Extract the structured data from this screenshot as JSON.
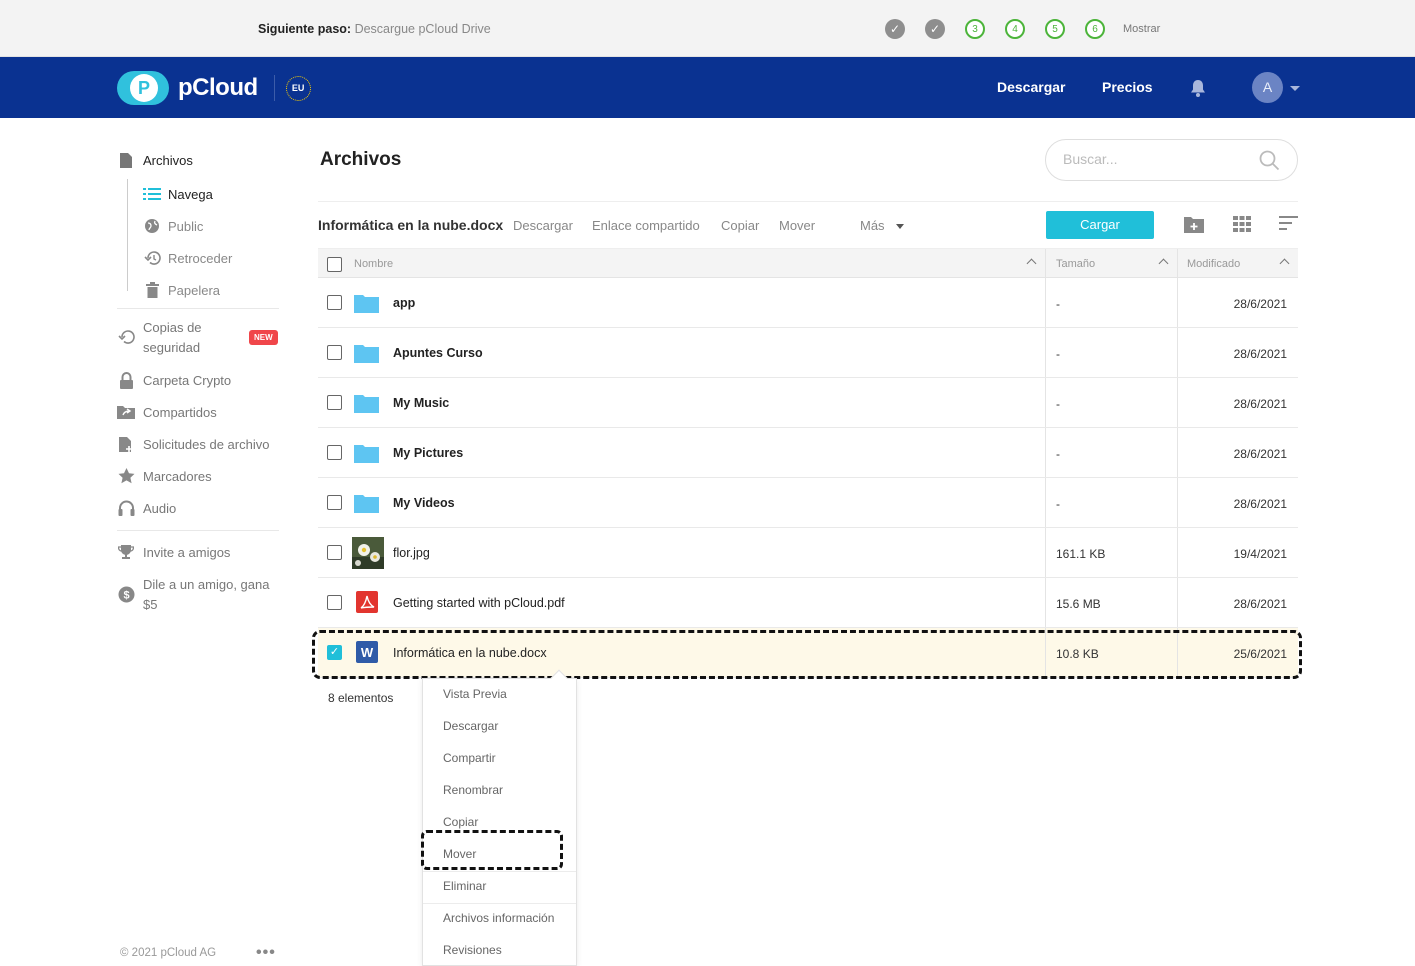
{
  "onboarding": {
    "next_label": "Siguiente paso:",
    "next_value": "Descargue pCloud Drive",
    "steps": [
      "✓",
      "✓",
      "3",
      "4",
      "5",
      "6"
    ],
    "show_label": "Mostrar"
  },
  "header": {
    "logo_text": "pCloud",
    "logo_letter": "P",
    "region_badge": "EU",
    "download_label": "Descargar",
    "pricing_label": "Precios",
    "avatar_letter": "A"
  },
  "sidebar": {
    "files_label": "Archivos",
    "sub": {
      "browse": "Navega",
      "public": "Public",
      "rewind": "Retroceder",
      "trash": "Papelera"
    },
    "backup_line1": "Copias de",
    "backup_line2": "seguridad",
    "new_badge": "NEW",
    "crypto": "Carpeta Crypto",
    "shared": "Compartidos",
    "file_requests": "Solicitudes de archivo",
    "bookmarks": "Marcadores",
    "audio": "Audio",
    "invite": "Invite a amigos",
    "refer_line1": "Dile a un amigo, gana",
    "refer_line2": "$5",
    "copyright": "© 2021 pCloud AG",
    "more": "•••"
  },
  "main": {
    "title": "Archivos",
    "search_placeholder": "Buscar...",
    "toolbar": {
      "selected_name": "Informática en la nube.docx",
      "download": "Descargar",
      "share_link": "Enlace compartido",
      "copy": "Copiar",
      "move": "Mover",
      "more": "Más",
      "upload": "Cargar"
    },
    "columns": {
      "name": "Nombre",
      "size": "Tamaño",
      "modified": "Modificado"
    },
    "rows": [
      {
        "name": "app",
        "size": "-",
        "date": "28/6/2021"
      },
      {
        "name": "Apuntes Curso",
        "size": "-",
        "date": "28/6/2021"
      },
      {
        "name": "My Music",
        "size": "-",
        "date": "28/6/2021"
      },
      {
        "name": "My Pictures",
        "size": "-",
        "date": "28/6/2021"
      },
      {
        "name": "My Videos",
        "size": "-",
        "date": "28/6/2021"
      },
      {
        "name": "flor.jpg",
        "size": "161.1 KB",
        "date": "19/4/2021"
      },
      {
        "name": "Getting started with pCloud.pdf",
        "size": "15.6 MB",
        "date": "28/6/2021"
      },
      {
        "name": "Informática en la nube.docx",
        "size": "10.8 KB",
        "date": "25/6/2021"
      }
    ],
    "count": "8 elementos"
  },
  "context_menu": {
    "preview": "Vista Previa",
    "download": "Descargar",
    "share": "Compartir",
    "rename": "Renombrar",
    "copy": "Copiar",
    "move": "Mover",
    "delete": "Eliminar",
    "file_info": "Archivos información",
    "revisions": "Revisiones"
  },
  "colors": {
    "header_bg": "#0a3291",
    "accent": "#20bfd9",
    "folder": "#5ec5f2",
    "selected_row": "#fef9e8",
    "step_todo": "#4cb43a"
  }
}
